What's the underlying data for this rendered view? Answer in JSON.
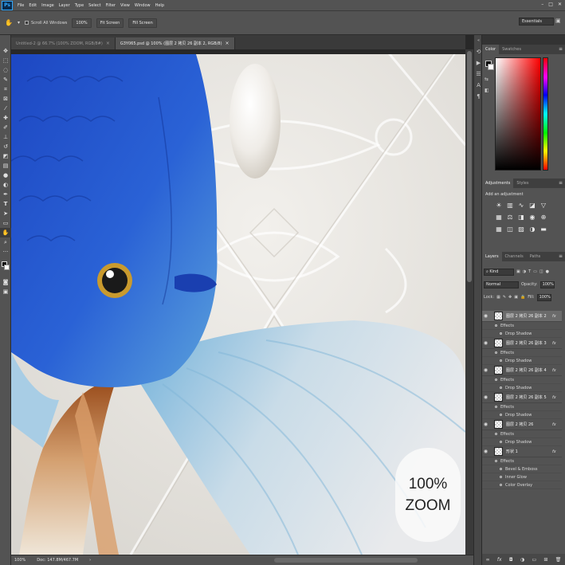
{
  "app": {
    "logo": "Ps"
  },
  "menu": [
    "File",
    "Edit",
    "Image",
    "Layer",
    "Type",
    "Select",
    "Filter",
    "View",
    "Window",
    "Help"
  ],
  "window_controls": [
    "–",
    "□",
    "✕"
  ],
  "options": {
    "scroll_all_windows": "Scroll All Windows",
    "zoom_100": "100%",
    "fit_screen": "Fit Screen",
    "fill_screen": "Fill Screen",
    "workspace": "Essentials"
  },
  "tabs": [
    {
      "label": "Untitled-2 @ 66.7% (100% ZOOM, RGB/8#)"
    },
    {
      "label": "G3Y065.psd @ 100% (图层 2 拷贝 26 副本 2, RGB/8)"
    }
  ],
  "canvas": {
    "zoom_badge_line1": "100%",
    "zoom_badge_line2": "ZOOM",
    "colors": {
      "fish_body": "#2a55c9",
      "fin": "#a9d0e8",
      "background": "#e6e3de",
      "pearl": "#f4f2ef"
    }
  },
  "status": {
    "zoom": "100%",
    "doc": "Doc: 147.8M/467.7M"
  },
  "color_panel": {
    "tabs": [
      "Color",
      "Swatches"
    ]
  },
  "adjustments_panel": {
    "tabs": [
      "Adjustments",
      "Styles"
    ],
    "add_label": "Add an adjustment"
  },
  "layers_panel": {
    "tabs": [
      "Layers",
      "Channels",
      "Paths"
    ],
    "filter_kind": "Kind",
    "blend_mode": "Normal",
    "opacity_label": "Opacity:",
    "opacity_value": "100%",
    "lock_label": "Lock:",
    "fill_label": "Fill:",
    "fill_value": "100%",
    "layers": [
      {
        "name": "图层 2 拷贝 26 副本 2",
        "fx": "fx",
        "effects": "Effects",
        "subs": [
          "Drop Shadow"
        ]
      },
      {
        "name": "图层 2 拷贝 26 副本 3",
        "fx": "fx",
        "effects": "Effects",
        "subs": [
          "Drop Shadow"
        ]
      },
      {
        "name": "图层 2 拷贝 26 副本 4",
        "fx": "fx",
        "effects": "Effects",
        "subs": [
          "Drop Shadow"
        ]
      },
      {
        "name": "图层 2 拷贝 26 副本 5",
        "fx": "fx",
        "effects": "Effects",
        "subs": [
          "Drop Shadow"
        ]
      },
      {
        "name": "图层 2 拷贝 26",
        "fx": "fx",
        "effects": "Effects",
        "subs": [
          "Drop Shadow"
        ]
      },
      {
        "name": "形状 1",
        "fx": "fx",
        "effects": "Effects",
        "subs": [
          "Bevel & Emboss",
          "Inner Glow",
          "Color Overlay"
        ]
      }
    ]
  }
}
